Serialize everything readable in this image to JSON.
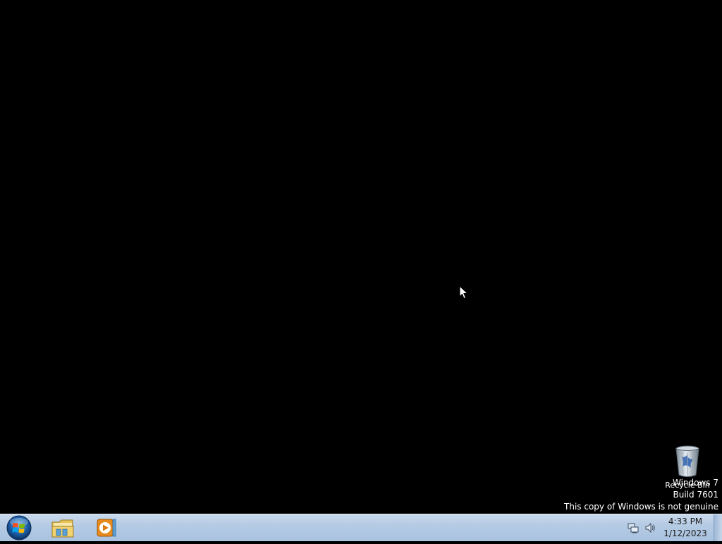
{
  "desktop": {
    "background_color": "#000000",
    "icons": [
      {
        "label": "Recycle Bin",
        "icon": "recycle-bin-icon"
      }
    ]
  },
  "watermark": {
    "line1": "Windows 7",
    "line2": "Build 7601",
    "line3": "This copy of Windows is not genuine"
  },
  "taskbar": {
    "start": {
      "icon": "windows-orb-icon"
    },
    "pinned": [
      {
        "name": "Windows Explorer",
        "icon": "folder-icon"
      },
      {
        "name": "Windows Media Player",
        "icon": "media-player-icon"
      }
    ],
    "tray": {
      "icons": [
        "network-icon",
        "volume-icon"
      ],
      "time": "4:33 PM",
      "date": "1/12/2023"
    },
    "background_color": "#b5cbe4"
  }
}
